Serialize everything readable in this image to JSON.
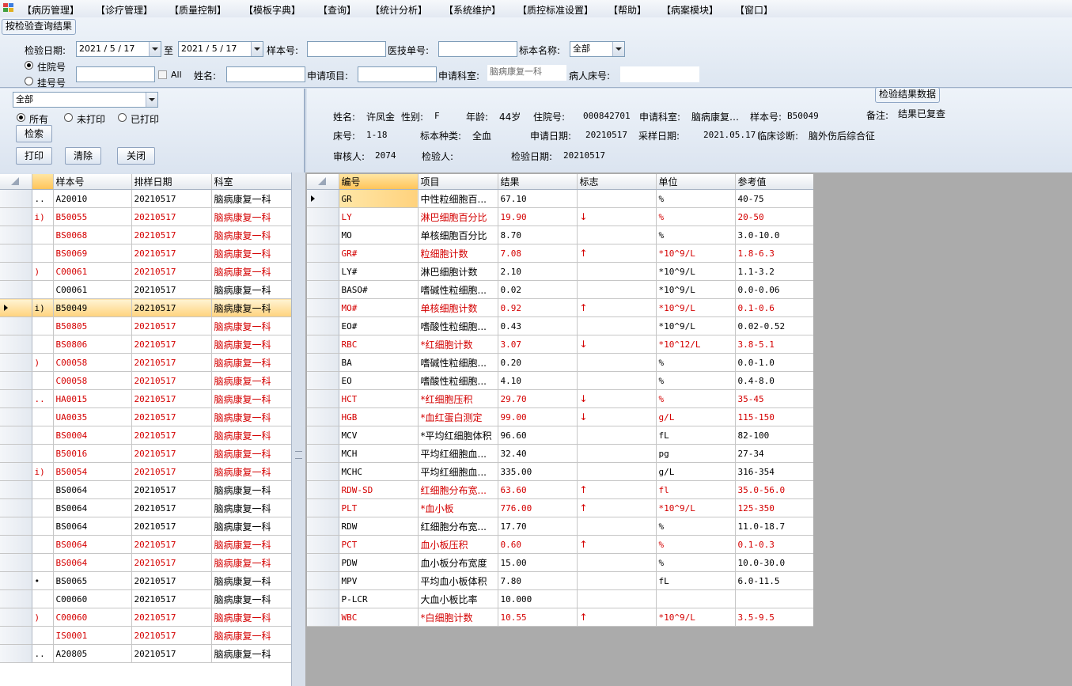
{
  "menu": [
    "【病历管理】",
    "【诊疗管理】",
    "【质量控制】",
    "【模板字典】",
    "【查询】",
    "【统计分析】",
    "【系统维护】",
    "【质控标准设置】",
    "【帮助】",
    "【病案模块】",
    "【窗口】"
  ],
  "query": {
    "group_title": "按检验查询结果",
    "date_label": "检验日期:",
    "date_from": "2021 / 5 / 17",
    "to_label": "至",
    "date_to": "2021 / 5 / 17",
    "sample_no_label": "样本号:",
    "sample_no_value": "",
    "tech_no_label": "医技单号:",
    "tech_no_value": "",
    "sample_name_label": "标本名称:",
    "sample_name_value": "全部",
    "radio_inpatient": "住院号",
    "radio_registration": "挂号号",
    "inpatient_no_value": "",
    "all_label": "All",
    "name_label": "姓名:",
    "name_value": "",
    "apply_item_label": "申请项目:",
    "apply_item_value": "",
    "apply_dept_label": "申请科室:",
    "apply_dept_value": "脑病康复一科",
    "bed_label": "病人床号:",
    "bed_value": ""
  },
  "left_panel": {
    "filter_value": "全部",
    "radio_all": "所有",
    "radio_unprinted": "未打印",
    "radio_printed": "已打印",
    "search_button": "检索",
    "print_button": "打印",
    "clear_button": "清除",
    "close_button": "关闭"
  },
  "info": {
    "title": "检验结果数据",
    "name_label": "姓名:",
    "name": "许凤金",
    "sex_label": "性别:",
    "sex": "F",
    "age_label": "年龄:",
    "age": "44岁",
    "inpatient_label": "住院号:",
    "inpatient_no": "000842701",
    "dept_label": "申请科室:",
    "dept": "脑病康复…",
    "sample_label": "样本号:",
    "sample_no": "B50049",
    "remark_label": "备注:",
    "remark": "结果已复查",
    "bed_label": "床号:",
    "bed": "1-18",
    "sample_type_label": "标本种类:",
    "sample_type": "全血",
    "apply_date_label": "申请日期:",
    "apply_date": "20210517",
    "collect_date_label": "采样日期:",
    "collect_date": "2021.05.17",
    "diagnosis_label": "临床诊断:",
    "diagnosis": "脑外伤后综合征",
    "reviewer_label": "审核人:",
    "reviewer": "2074",
    "tester_label": "检验人:",
    "tester": "",
    "test_date_label": "检验日期:",
    "test_date": "20210517"
  },
  "sample_grid": {
    "headers": [
      "样本号",
      "排样日期",
      "科室"
    ],
    "rows": [
      {
        "mark": "..",
        "no": "A20010",
        "date": "20210517",
        "dept": "脑病康复一科",
        "red": false
      },
      {
        "mark": "i)",
        "no": "B50055",
        "date": "20210517",
        "dept": "脑病康复一科",
        "red": true
      },
      {
        "mark": "",
        "no": "BS0068",
        "date": "20210517",
        "dept": "脑病康复一科",
        "red": true
      },
      {
        "mark": "",
        "no": "BS0069",
        "date": "20210517",
        "dept": "脑病康复一科",
        "red": true
      },
      {
        "mark": ")",
        "no": "C00061",
        "date": "20210517",
        "dept": "脑病康复一科",
        "red": true
      },
      {
        "mark": "",
        "no": "C00061",
        "date": "20210517",
        "dept": "脑病康复一科",
        "red": false
      },
      {
        "mark": "i)",
        "no": "B50049",
        "date": "20210517",
        "dept": "脑病康复一科",
        "red": false,
        "current": true
      },
      {
        "mark": "",
        "no": "B50805",
        "date": "20210517",
        "dept": "脑病康复一科",
        "red": true
      },
      {
        "mark": "",
        "no": "BS0806",
        "date": "20210517",
        "dept": "脑病康复一科",
        "red": true
      },
      {
        "mark": ")",
        "no": "C00058",
        "date": "20210517",
        "dept": "脑病康复一科",
        "red": true
      },
      {
        "mark": "",
        "no": "C00058",
        "date": "20210517",
        "dept": "脑病康复一科",
        "red": true
      },
      {
        "mark": "..",
        "no": "HA0015",
        "date": "20210517",
        "dept": "脑病康复一科",
        "red": true
      },
      {
        "mark": "",
        "no": "UA0035",
        "date": "20210517",
        "dept": "脑病康复一科",
        "red": true
      },
      {
        "mark": "",
        "no": "BS0004",
        "date": "20210517",
        "dept": "脑病康复一科",
        "red": true
      },
      {
        "mark": "",
        "no": "B50016",
        "date": "20210517",
        "dept": "脑病康复一科",
        "red": true
      },
      {
        "mark": "i)",
        "no": "B50054",
        "date": "20210517",
        "dept": "脑病康复一科",
        "red": true
      },
      {
        "mark": "",
        "no": "BS0064",
        "date": "20210517",
        "dept": "脑病康复一科",
        "red": false
      },
      {
        "mark": "",
        "no": "BS0064",
        "date": "20210517",
        "dept": "脑病康复一科",
        "red": false
      },
      {
        "mark": "",
        "no": "BS0064",
        "date": "20210517",
        "dept": "脑病康复一科",
        "red": false
      },
      {
        "mark": "",
        "no": "BS0064",
        "date": "20210517",
        "dept": "脑病康复一科",
        "red": true
      },
      {
        "mark": "",
        "no": "BS0064",
        "date": "20210517",
        "dept": "脑病康复一科",
        "red": true
      },
      {
        "mark": "•",
        "no": "BS0065",
        "date": "20210517",
        "dept": "脑病康复一科",
        "red": false
      },
      {
        "mark": "",
        "no": "C00060",
        "date": "20210517",
        "dept": "脑病康复一科",
        "red": false
      },
      {
        "mark": ")",
        "no": "C00060",
        "date": "20210517",
        "dept": "脑病康复一科",
        "red": true
      },
      {
        "mark": "",
        "no": "IS0001",
        "date": "20210517",
        "dept": "脑病康复一科",
        "red": true
      },
      {
        "mark": "..",
        "no": "A20805",
        "date": "20210517",
        "dept": "脑病康复一科",
        "red": false
      }
    ]
  },
  "result_grid": {
    "headers": [
      "编号",
      "项目",
      "结果",
      "标志",
      "单位",
      "参考值"
    ],
    "rows": [
      {
        "code": "GR",
        "item": "中性粒细胞百...",
        "result": "67.10",
        "flag": "",
        "unit": "%",
        "ref": "40-75",
        "red": false
      },
      {
        "code": "LY",
        "item": "淋巴细胞百分比",
        "result": "19.90",
        "flag": "↓",
        "unit": "%",
        "ref": "20-50",
        "red": true
      },
      {
        "code": "MO",
        "item": "单核细胞百分比",
        "result": "8.70",
        "flag": "",
        "unit": "%",
        "ref": "3.0-10.0",
        "red": false
      },
      {
        "code": "GR#",
        "item": "粒细胞计数",
        "result": "7.08",
        "flag": "↑",
        "unit": "*10^9/L",
        "ref": "1.8-6.3",
        "red": true
      },
      {
        "code": "LY#",
        "item": "淋巴细胞计数",
        "result": "2.10",
        "flag": "",
        "unit": "*10^9/L",
        "ref": "1.1-3.2",
        "red": false
      },
      {
        "code": "BASO#",
        "item": "嗜碱性粒细胞...",
        "result": "0.02",
        "flag": "",
        "unit": "*10^9/L",
        "ref": "0.0-0.06",
        "red": false
      },
      {
        "code": "MO#",
        "item": "单核细胞计数",
        "result": "0.92",
        "flag": "↑",
        "unit": "*10^9/L",
        "ref": "0.1-0.6",
        "red": true
      },
      {
        "code": "EO#",
        "item": "嗜酸性粒细胞...",
        "result": "0.43",
        "flag": "",
        "unit": "*10^9/L",
        "ref": "0.02-0.52",
        "red": false
      },
      {
        "code": "RBC",
        "item": "*红细胞计数",
        "result": "3.07",
        "flag": "↓",
        "unit": "*10^12/L",
        "ref": "3.8-5.1",
        "red": true
      },
      {
        "code": "BA",
        "item": "嗜碱性粒细胞...",
        "result": "0.20",
        "flag": "",
        "unit": "%",
        "ref": "0.0-1.0",
        "red": false
      },
      {
        "code": "EO",
        "item": "嗜酸性粒细胞...",
        "result": "4.10",
        "flag": "",
        "unit": "%",
        "ref": "0.4-8.0",
        "red": false
      },
      {
        "code": "HCT",
        "item": "*红细胞压积",
        "result": "29.70",
        "flag": "↓",
        "unit": "%",
        "ref": "35-45",
        "red": true
      },
      {
        "code": "HGB",
        "item": "*血红蛋白测定",
        "result": "99.00",
        "flag": "↓",
        "unit": "g/L",
        "ref": "115-150",
        "red": true
      },
      {
        "code": "MCV",
        "item": "*平均红细胞体积",
        "result": "96.60",
        "flag": "",
        "unit": "fL",
        "ref": "82-100",
        "red": false
      },
      {
        "code": "MCH",
        "item": "平均红细胞血...",
        "result": "32.40",
        "flag": "",
        "unit": "pg",
        "ref": "27-34",
        "red": false
      },
      {
        "code": "MCHC",
        "item": "平均红细胞血...",
        "result": "335.00",
        "flag": "",
        "unit": "g/L",
        "ref": "316-354",
        "red": false
      },
      {
        "code": "RDW-SD",
        "item": "红细胞分布宽...",
        "result": "63.60",
        "flag": "↑",
        "unit": "fl",
        "ref": "35.0-56.0",
        "red": true
      },
      {
        "code": "PLT",
        "item": "*血小板",
        "result": "776.00",
        "flag": "↑",
        "unit": "*10^9/L",
        "ref": "125-350",
        "red": true
      },
      {
        "code": "RDW",
        "item": "红细胞分布宽...",
        "result": "17.70",
        "flag": "",
        "unit": "%",
        "ref": "11.0-18.7",
        "red": false
      },
      {
        "code": "PCT",
        "item": "血小板压积",
        "result": "0.60",
        "flag": "↑",
        "unit": "%",
        "ref": "0.1-0.3",
        "red": true
      },
      {
        "code": "PDW",
        "item": "血小板分布宽度",
        "result": "15.00",
        "flag": "",
        "unit": "%",
        "ref": "10.0-30.0",
        "red": false
      },
      {
        "code": "MPV",
        "item": "平均血小板体积",
        "result": "7.80",
        "flag": "",
        "unit": "fL",
        "ref": "6.0-11.5",
        "red": false
      },
      {
        "code": "P-LCR",
        "item": "大血小板比率",
        "result": "10.000",
        "flag": "",
        "unit": "",
        "ref": "",
        "red": false
      },
      {
        "code": "WBC",
        "item": "*白细胞计数",
        "result": "10.55",
        "flag": "↑",
        "unit": "*10^9/L",
        "ref": "3.5-9.5",
        "red": true
      }
    ]
  }
}
